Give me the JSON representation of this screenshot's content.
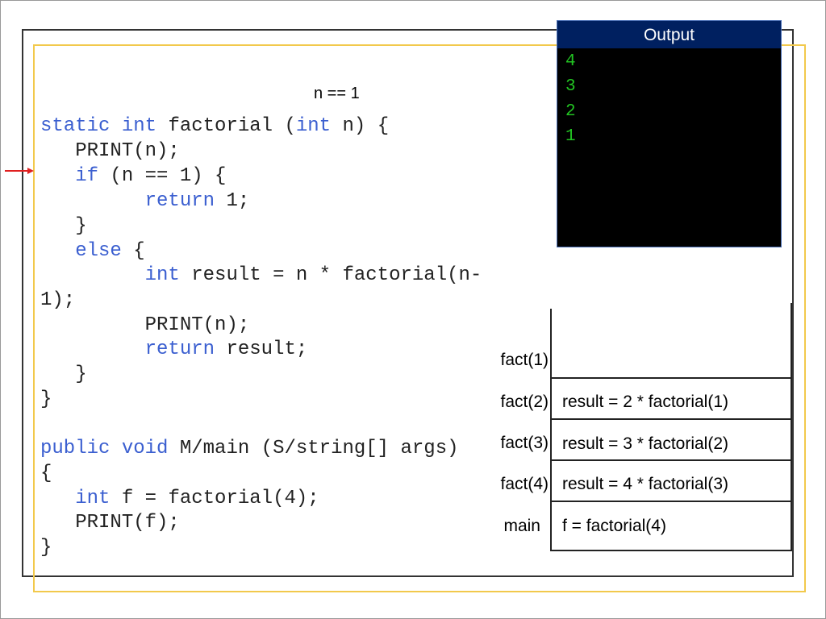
{
  "condition_label": "n == 1",
  "output": {
    "title": "Output",
    "lines": [
      "4",
      "3",
      "2",
      "1"
    ],
    "header_color": "#002060",
    "text_color": "#22c322"
  },
  "code": [
    [
      {
        "t": "static ",
        "kw": true
      },
      {
        "t": "int ",
        "kw": true
      },
      {
        "t": "factorial ("
      },
      {
        "t": "int",
        "kw": true
      },
      {
        "t": " n) {"
      }
    ],
    [
      {
        "t": "   PRINT(n);"
      }
    ],
    [
      {
        "t": "   "
      },
      {
        "t": "if",
        "kw": true
      },
      {
        "t": " (n == 1) {"
      }
    ],
    [
      {
        "t": "         "
      },
      {
        "t": "return",
        "kw": true
      },
      {
        "t": " 1;"
      }
    ],
    [
      {
        "t": "   }"
      }
    ],
    [
      {
        "t": "   "
      },
      {
        "t": "else",
        "kw": true
      },
      {
        "t": " {"
      }
    ],
    [
      {
        "t": "         "
      },
      {
        "t": "int",
        "kw": true
      },
      {
        "t": " result = n * factorial(n-"
      }
    ],
    [
      {
        "t": "1);"
      }
    ],
    [
      {
        "t": "         PRINT(n);"
      }
    ],
    [
      {
        "t": "         "
      },
      {
        "t": "return",
        "kw": true
      },
      {
        "t": " result;"
      }
    ],
    [
      {
        "t": "   }"
      }
    ],
    [
      {
        "t": "}"
      }
    ],
    [
      {
        "t": ""
      }
    ],
    [
      {
        "t": "public ",
        "kw": true
      },
      {
        "t": "void ",
        "kw": true
      },
      {
        "t": "M/main (S/string[] args)"
      }
    ],
    [
      {
        "t": "{"
      }
    ],
    [
      {
        "t": "   "
      },
      {
        "t": "int",
        "kw": true
      },
      {
        "t": " f = factorial(4);"
      }
    ],
    [
      {
        "t": "   PRINT(f);"
      }
    ],
    [
      {
        "t": "}"
      }
    ]
  ],
  "current_line_indicator": "red-arrow-icon",
  "stack": {
    "frames": [
      {
        "label": "fact(1)",
        "text": ""
      },
      {
        "label": "fact(2)",
        "text": "result = 2 * factorial(1)"
      },
      {
        "label": "fact(3)",
        "text": "result = 3 * factorial(2)"
      },
      {
        "label": "fact(4)",
        "text": "result = 4 * factorial(3)"
      },
      {
        "label": "main",
        "text": "f = factorial(4)"
      }
    ]
  }
}
